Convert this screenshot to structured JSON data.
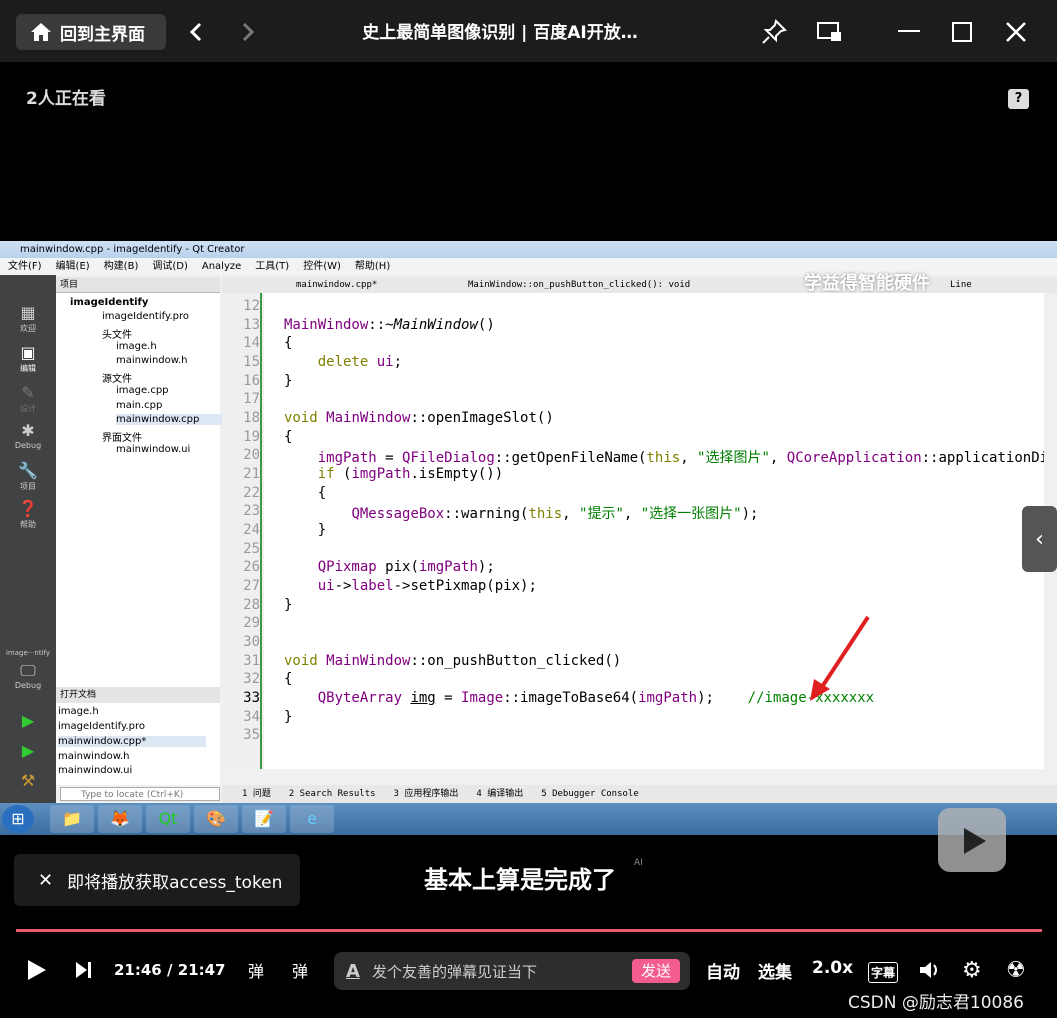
{
  "top": {
    "home_label": "回到主界面",
    "title": "史上最简单图像识别 | 百度AI开放…",
    "watchers": "2人正在看"
  },
  "qt": {
    "window_title": "mainwindow.cpp - imageIdentify - Qt Creator",
    "menu": [
      "文件(F)",
      "编辑(E)",
      "构建(B)",
      "调试(D)",
      "Analyze",
      "工具(T)",
      "控件(W)",
      "帮助(H)"
    ],
    "modes": [
      "欢迎",
      "编辑",
      "设计",
      "Debug",
      "项目",
      "帮助"
    ],
    "kit_label": "image···ntify",
    "kit_mode": "Debug",
    "project_header": "项目",
    "tree": [
      "imageIdentify",
      "imageIdentify.pro",
      "头文件",
      "image.h",
      "mainwindow.h",
      "源文件",
      "image.cpp",
      "main.cpp",
      "mainwindow.cpp",
      "界面文件",
      "mainwindow.ui"
    ],
    "open_docs_header": "打开文档",
    "open_docs": [
      "image.h",
      "imageIdentify.pro",
      "mainwindow.cpp*",
      "mainwindow.h",
      "mainwindow.ui"
    ],
    "editor_tab": "mainwindow.cpp*",
    "editor_symbol": "MainWindow::on_pushButton_clicked(): void",
    "editor_right": "Line",
    "line_numbers": [
      "12",
      "13",
      "14",
      "15",
      "16",
      "17",
      "18",
      "19",
      "20",
      "21",
      "22",
      "23",
      "24",
      "25",
      "26",
      "27",
      "28",
      "29",
      "30",
      "31",
      "32",
      "33",
      "34",
      "35"
    ],
    "locate_placeholder": "Type to locate (Ctrl+K)",
    "output_tabs": [
      "1 问题",
      "2 Search Results",
      "3 应用程序输出",
      "4 编译输出",
      "5 Debugger Console"
    ],
    "brand": "学益得智能硬件"
  },
  "subtitle": "基本上算是完成了",
  "ai_tag": "AI",
  "notice": "即将播放获取access_token",
  "player": {
    "time_current": "21:46",
    "time_sep": "/",
    "time_total": "21:47",
    "danmu_placeholder": "发个友善的弹幕见证当下",
    "send": "发送",
    "auto": "自动",
    "episodes": "选集",
    "speed": "2.0x",
    "cc": "字幕"
  },
  "watermark": "CSDN @励志君10086"
}
